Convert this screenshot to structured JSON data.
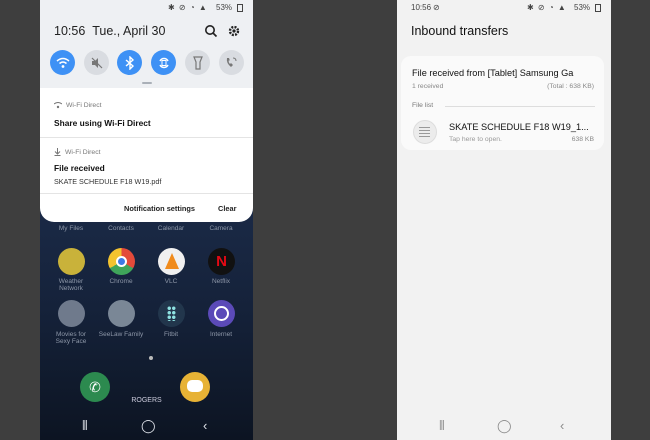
{
  "left_phone": {
    "status_bar": {
      "battery": "53%"
    },
    "time": "10:56",
    "date": "Tue., April 30",
    "quick_settings": [
      {
        "name": "wifi",
        "on": true
      },
      {
        "name": "sound-off",
        "on": false
      },
      {
        "name": "bluetooth",
        "on": true
      },
      {
        "name": "auto-rotate",
        "on": true
      },
      {
        "name": "flashlight",
        "on": false
      },
      {
        "name": "wifi-calling",
        "on": false
      }
    ],
    "notification_1": {
      "source": "Wi-Fi Direct",
      "title": "Share using Wi-Fi Direct"
    },
    "notification_2": {
      "source": "Wi-Fi Direct",
      "title": "File received",
      "body": "SKATE SCHEDULE F18 W19.pdf"
    },
    "actions": {
      "settings": "Notification settings",
      "clear": "Clear"
    },
    "home_labels": {
      "row1": [
        "My Files",
        "Contacts",
        "Calendar",
        "Camera"
      ],
      "row2": [
        "Weather Network",
        "Chrome",
        "VLC",
        "Netflix"
      ],
      "row3": [
        "Movies for Sexy Face",
        "SeeLaw Family",
        "Fitbit",
        "Internet"
      ]
    },
    "carrier": "ROGERS"
  },
  "right_phone": {
    "status_bar": {
      "time": "10:56",
      "battery": "53%"
    },
    "title": "Inbound transfers",
    "transfer": {
      "title": "File received from [Tablet] Samsung Ga",
      "received": "1 received",
      "total": "(Total : 638 KB)",
      "file_list_label": "File list",
      "file_name": "SKATE SCHEDULE F18 W19_1...",
      "file_hint": "Tap here to open.",
      "file_size": "638 KB"
    }
  },
  "colors": {
    "accent": "#3e91f5",
    "panel": "#ffffff",
    "wallpaper": "#1b2a44"
  }
}
